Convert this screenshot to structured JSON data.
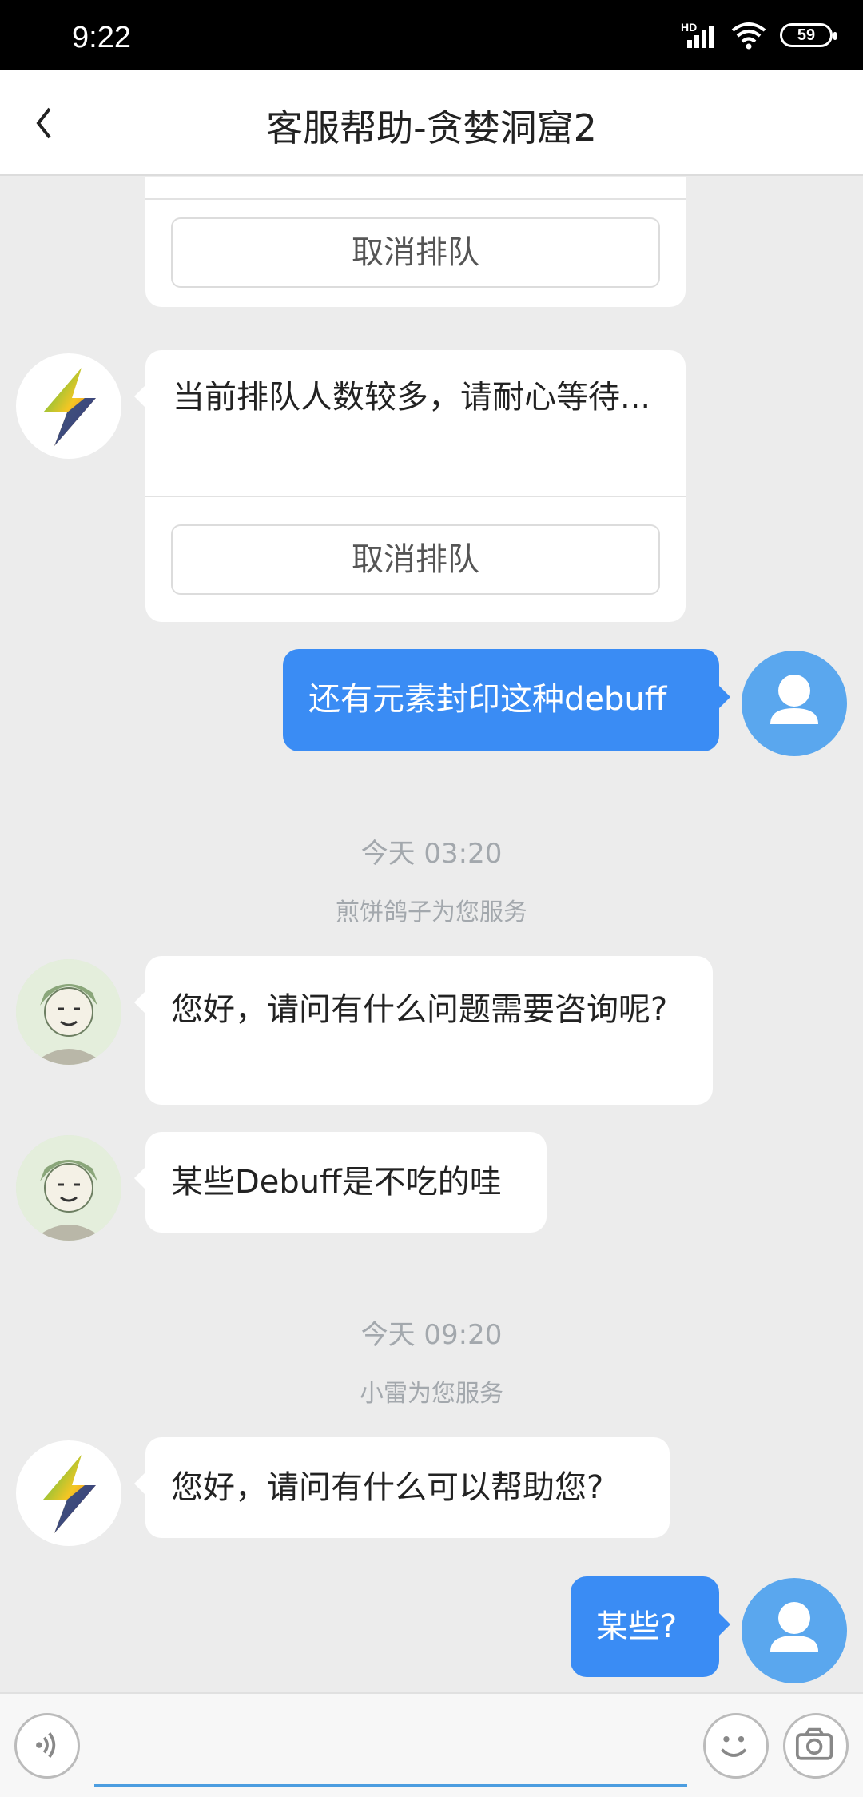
{
  "status_bar": {
    "time": "9:22",
    "battery": "59",
    "network": "HD"
  },
  "header": {
    "title": "客服帮助-贪婪洞窟2",
    "back_icon": "chevron-left-icon"
  },
  "messages": {
    "cancel_label": "取消排队",
    "queue_notice": "当前排队人数较多，请耐心等待...",
    "user_msg_1": "还有元素封印这种debuff",
    "timestamp_1": "今天 03:20",
    "service_1": "煎饼鸽子为您服务",
    "agent_msg_1": "您好，请问有什么问题需要咨询呢?",
    "agent_msg_2": "某些Debuff是不吃的哇",
    "timestamp_2": "今天 09:20",
    "service_2": "小雷为您服务",
    "bot_msg_1": "您好，请问有什么可以帮助您?",
    "user_msg_2": "某些?"
  },
  "input_bar": {
    "voice_icon": "voice-icon",
    "emoji_icon": "smiley-icon",
    "camera_icon": "camera-icon",
    "input_value": ""
  },
  "colors": {
    "accent": "#3a8cf4",
    "user_avatar": "#5aa7ee",
    "background": "#ececec"
  }
}
